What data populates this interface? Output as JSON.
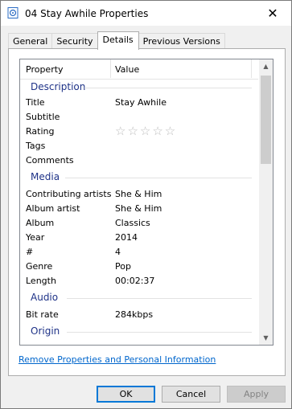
{
  "window": {
    "title": "04 Stay Awhile Properties",
    "close": "✕"
  },
  "tabs": [
    {
      "label": "General"
    },
    {
      "label": "Security"
    },
    {
      "label": "Details"
    },
    {
      "label": "Previous Versions"
    }
  ],
  "columns": {
    "property": "Property",
    "value": "Value"
  },
  "groups": {
    "description": "Description",
    "media": "Media",
    "audio": "Audio",
    "origin": "Origin"
  },
  "description": {
    "title_k": "Title",
    "title_v": "Stay Awhile",
    "subtitle_k": "Subtitle",
    "rating_k": "Rating",
    "rating_stars": "☆☆☆☆☆",
    "tags_k": "Tags",
    "comments_k": "Comments"
  },
  "media": {
    "artists_k": "Contributing artists",
    "artists_v": "She & Him",
    "album_artist_k": "Album artist",
    "album_artist_v": "She & Him",
    "album_k": "Album",
    "album_v": "Classics",
    "year_k": "Year",
    "year_v": "2014",
    "track_k": "#",
    "track_v": "4",
    "genre_k": "Genre",
    "genre_v": "Pop",
    "length_k": "Length",
    "length_v": "00:02:37"
  },
  "audio": {
    "bitrate_k": "Bit rate",
    "bitrate_v": "284kbps"
  },
  "link": "Remove Properties and Personal Information",
  "buttons": {
    "ok": "OK",
    "cancel": "Cancel",
    "apply": "Apply"
  }
}
